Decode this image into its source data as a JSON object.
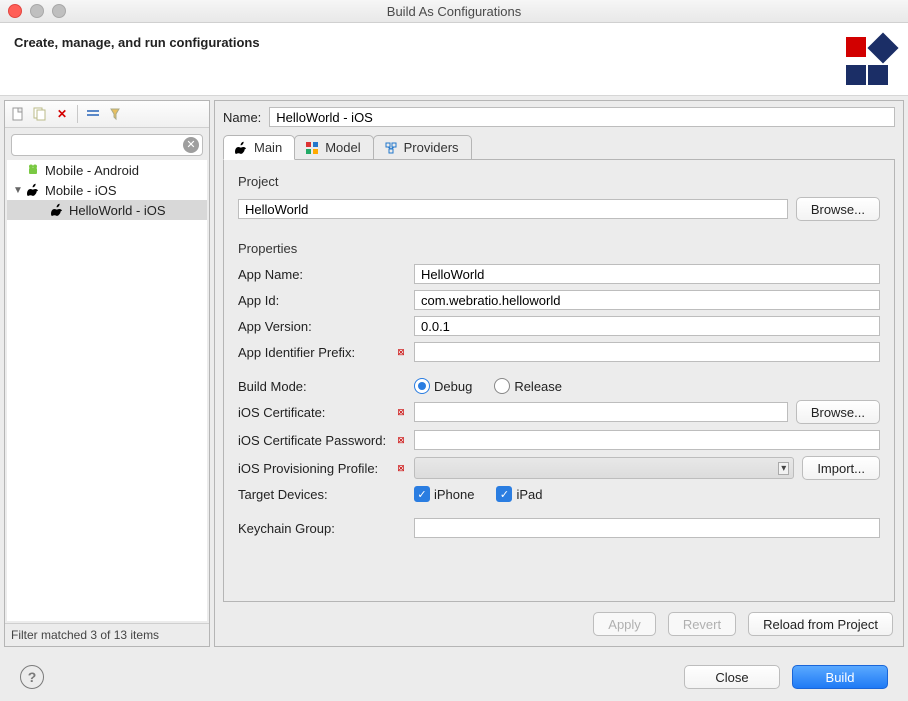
{
  "window": {
    "title": "Build As Configurations",
    "subtitle": "Create, manage, and run configurations"
  },
  "left": {
    "toolbar": {
      "new": "new-config",
      "copy": "copy-config",
      "delete": "delete-config",
      "collapse": "collapse-all",
      "filter_toggle": "filter-toggle"
    },
    "filter_value": "",
    "tree": {
      "item0": {
        "label": "Mobile - Android"
      },
      "item1": {
        "label": "Mobile - iOS"
      },
      "item1_child0": {
        "label": "HelloWorld - iOS"
      }
    },
    "status": "Filter matched 3 of 13 items"
  },
  "form": {
    "name_label": "Name:",
    "name_value": "HelloWorld - iOS",
    "tabs": {
      "main": "Main",
      "model": "Model",
      "providers": "Providers"
    },
    "project": {
      "section_title": "Project",
      "value": "HelloWorld",
      "browse": "Browse..."
    },
    "properties": {
      "section_title": "Properties",
      "app_name_label": "App Name:",
      "app_name_value": "HelloWorld",
      "app_id_label": "App Id:",
      "app_id_value": "com.webratio.helloworld",
      "app_version_label": "App Version:",
      "app_version_value": "0.0.1",
      "app_id_prefix_label": "App Identifier Prefix:",
      "app_id_prefix_value": "",
      "build_mode_label": "Build Mode:",
      "build_mode_debug": "Debug",
      "build_mode_release": "Release",
      "build_mode_selected": "Debug",
      "ios_cert_label": "iOS Certificate:",
      "ios_cert_value": "",
      "ios_cert_browse": "Browse...",
      "ios_cert_pw_label": "iOS Certificate Password:",
      "ios_cert_pw_value": "",
      "ios_prov_label": "iOS Provisioning Profile:",
      "ios_prov_value": "",
      "ios_prov_import": "Import...",
      "target_devices_label": "Target Devices:",
      "target_iphone": "iPhone",
      "target_ipad": "iPad",
      "target_iphone_checked": true,
      "target_ipad_checked": true,
      "keychain_label": "Keychain Group:",
      "keychain_value": ""
    },
    "apply": "Apply",
    "revert": "Revert",
    "reload": "Reload from Project"
  },
  "footer": {
    "close": "Close",
    "build": "Build"
  }
}
